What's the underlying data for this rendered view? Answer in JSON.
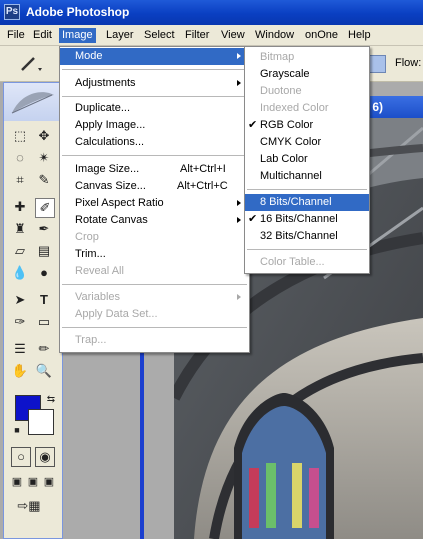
{
  "app": {
    "title": "Adobe Photoshop"
  },
  "menubar": {
    "items": [
      "File",
      "Edit",
      "Image",
      "Layer",
      "Select",
      "Filter",
      "View",
      "Window",
      "onOne",
      "Help"
    ]
  },
  "options_bar": {
    "flow_label": "Flow:"
  },
  "document": {
    "title_fragment": "6)"
  },
  "image_menu": {
    "items": [
      {
        "label": "Mode",
        "submenu": true,
        "selected": true
      },
      {
        "label": "Adjustments",
        "submenu": true
      },
      {
        "label": "Duplicate...",
        "submenu": false
      },
      {
        "label": "Apply Image...",
        "submenu": false
      },
      {
        "label": "Calculations...",
        "submenu": false
      },
      {
        "label": "Image Size...",
        "shortcut": "Alt+Ctrl+I"
      },
      {
        "label": "Canvas Size...",
        "shortcut": "Alt+Ctrl+C"
      },
      {
        "label": "Pixel Aspect Ratio",
        "submenu": true
      },
      {
        "label": "Rotate Canvas",
        "submenu": true
      },
      {
        "label": "Crop",
        "disabled": true
      },
      {
        "label": "Trim...",
        "submenu": false
      },
      {
        "label": "Reveal All",
        "disabled": true
      },
      {
        "label": "Variables",
        "disabled": true,
        "submenu": true
      },
      {
        "label": "Apply Data Set...",
        "disabled": true
      },
      {
        "label": "Trap...",
        "disabled": true
      }
    ]
  },
  "mode_submenu": {
    "items": [
      {
        "label": "Bitmap",
        "disabled": true
      },
      {
        "label": "Grayscale"
      },
      {
        "label": "Duotone",
        "disabled": true
      },
      {
        "label": "Indexed Color",
        "disabled": true
      },
      {
        "label": "RGB Color",
        "checked": true
      },
      {
        "label": "CMYK Color"
      },
      {
        "label": "Lab Color"
      },
      {
        "label": "Multichannel"
      },
      {
        "label": "8 Bits/Channel",
        "selected": true
      },
      {
        "label": "16 Bits/Channel",
        "checked": true
      },
      {
        "label": "32 Bits/Channel"
      },
      {
        "label": "Color Table...",
        "disabled": true
      }
    ]
  },
  "colors": {
    "menu_highlight": "#316ac5",
    "foreground_swatch": "#0d12ca",
    "background_swatch": "#ffffff",
    "titlebar": "#0a3fc2"
  }
}
